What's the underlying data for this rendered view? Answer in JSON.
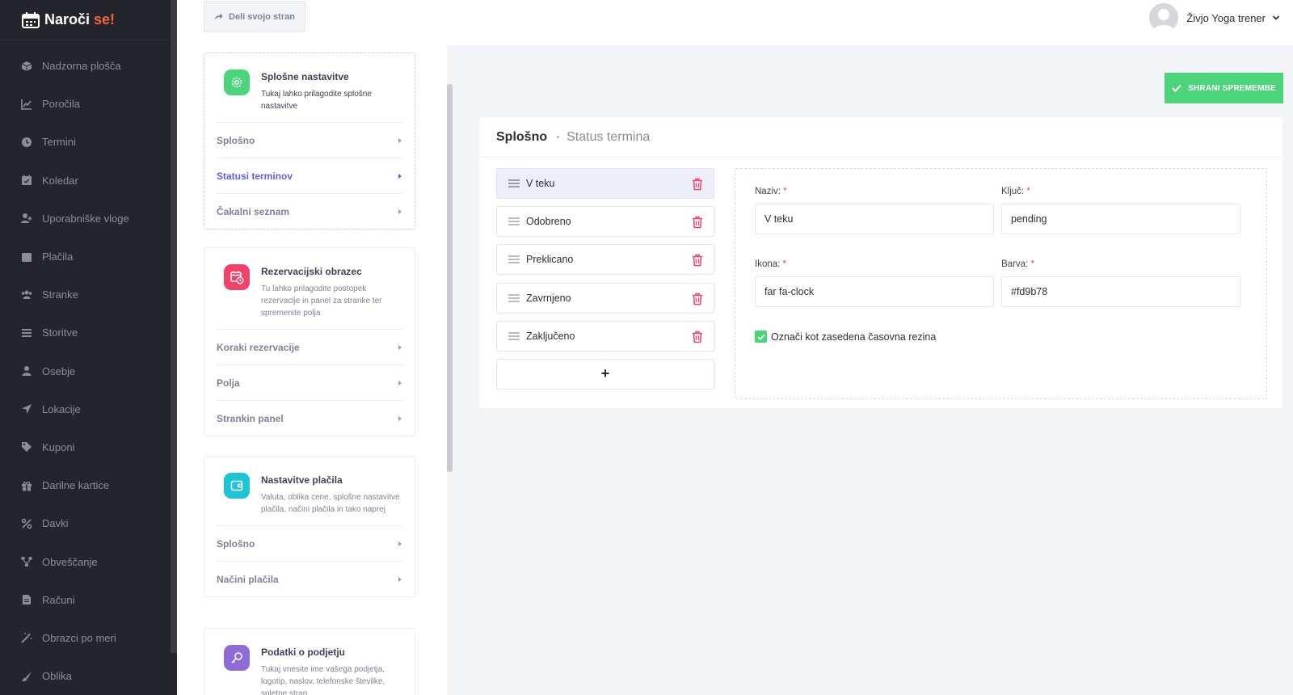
{
  "brand": {
    "name": "Naroči",
    "accent": "se!"
  },
  "sidebar": {
    "items": [
      {
        "label": "Nadzorna plošča",
        "icon": "cube-icon"
      },
      {
        "label": "Poročila",
        "icon": "chart-icon"
      },
      {
        "label": "Termini",
        "icon": "clock-icon"
      },
      {
        "label": "Koledar",
        "icon": "calendar-icon"
      },
      {
        "label": "Uporabniške vloge",
        "icon": "user-plus-icon"
      },
      {
        "label": "Plačila",
        "icon": "wallet-icon"
      },
      {
        "label": "Stranke",
        "icon": "users-icon"
      },
      {
        "label": "Storitve",
        "icon": "list-icon"
      },
      {
        "label": "Osebje",
        "icon": "user-icon"
      },
      {
        "label": "Lokacije",
        "icon": "location-arrow-icon"
      },
      {
        "label": "Kuponi",
        "icon": "tag-icon"
      },
      {
        "label": "Darilne kartice",
        "icon": "gift-icon"
      },
      {
        "label": "Davki",
        "icon": "percent-icon"
      },
      {
        "label": "Obveščanje",
        "icon": "sitemap-icon"
      },
      {
        "label": "Računi",
        "icon": "invoice-icon"
      },
      {
        "label": "Obrazci po meri",
        "icon": "magic-icon"
      },
      {
        "label": "Oblika",
        "icon": "brush-icon"
      }
    ]
  },
  "topbar": {
    "share_label": "Deli svojo stran",
    "user_name": "Živjo Yoga trener"
  },
  "settings_cards": {
    "general": {
      "title": "Splošne nastavitve",
      "desc": "Tukaj lahko prilagodite splošne nastavitve",
      "items": [
        "Splošno",
        "Statusi terminov",
        "Čakalni seznam"
      ]
    },
    "booking": {
      "title": "Rezervacijski obrazec",
      "desc": "Tu lahko prilagodite postopek rezervacije in panel za stranke ter spremenite polja",
      "items": [
        "Koraki rezervacije",
        "Polja",
        "Strankin panel"
      ]
    },
    "payments": {
      "title": "Nastavitve plačila",
      "desc": "Valuta, oblika cene, splošne nastavitve plačila, načini plačila in tako naprej",
      "items": [
        "Splošno",
        "Načini plačila"
      ]
    },
    "company": {
      "title": "Podatki o podjetju",
      "desc": "Tukaj vnesite ime vašega podjetja, logotip, naslov, telefonske številke, spletne stran"
    }
  },
  "save_label": "SHRANI SPREMEMBE",
  "main": {
    "breadcrumb_title": "Splošno",
    "breadcrumb_sub": "Status termina",
    "statuses": [
      "V teku",
      "Odobreno",
      "Preklicano",
      "Zavrnjeno",
      "Zaključeno"
    ],
    "add_label": "+",
    "form": {
      "name_label": "Naziv:",
      "name_value": "V teku",
      "key_label": "Ključ:",
      "key_value": "pending",
      "icon_label": "Ikona:",
      "icon_value": "far fa-clock",
      "color_label": "Barva:",
      "color_value": "#fd9b78",
      "required_mark": "*",
      "busy_label": "Označi kot zasedena časovna rezina",
      "busy_checked": true
    }
  },
  "colors": {
    "sidebar_bg": "#24252c",
    "accent_orange": "#f2663a",
    "save_green": "#4cd47a",
    "active_link": "#5d5fef",
    "delete_red": "#f1416c",
    "icon_general": "#4cd47a",
    "icon_booking": "#f1416c",
    "icon_payments": "#1bc5d6",
    "icon_company": "#8e6bd6"
  }
}
